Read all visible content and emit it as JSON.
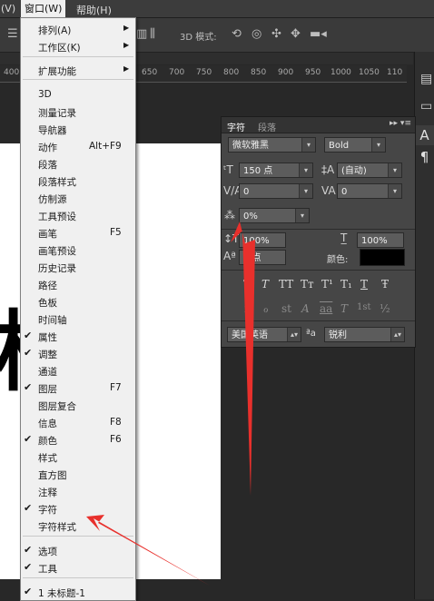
{
  "menubar": {
    "left_cut": "(V)",
    "window": "窗口(W)",
    "help": "帮助(H)"
  },
  "options_bar": {
    "mode_label": "3D 模式:"
  },
  "ruler": {
    "ticks": [
      "400",
      "650",
      "700",
      "750",
      "800",
      "850",
      "900",
      "950",
      "1000",
      "1050",
      "110"
    ]
  },
  "window_menu": {
    "items": [
      {
        "label": "排列(A)",
        "submenu": true
      },
      {
        "label": "工作区(K)",
        "submenu": true
      },
      {
        "label": "扩展功能",
        "submenu": true
      },
      {
        "label": "3D"
      },
      {
        "label": "测量记录"
      },
      {
        "label": "导航器"
      },
      {
        "label": "动作",
        "shortcut": "Alt+F9"
      },
      {
        "label": "段落"
      },
      {
        "label": "段落样式"
      },
      {
        "label": "仿制源"
      },
      {
        "label": "工具预设"
      },
      {
        "label": "画笔",
        "shortcut": "F5"
      },
      {
        "label": "画笔预设"
      },
      {
        "label": "历史记录"
      },
      {
        "label": "路径"
      },
      {
        "label": "色板"
      },
      {
        "label": "时间轴"
      },
      {
        "label": "属性",
        "checked": true
      },
      {
        "label": "调整",
        "checked": true
      },
      {
        "label": "通道"
      },
      {
        "label": "图层",
        "shortcut": "F7",
        "checked": true
      },
      {
        "label": "图层复合"
      },
      {
        "label": "信息",
        "shortcut": "F8"
      },
      {
        "label": "颜色",
        "shortcut": "F6",
        "checked": true
      },
      {
        "label": "样式"
      },
      {
        "label": "直方图"
      },
      {
        "label": "注释"
      },
      {
        "label": "字符",
        "checked": true
      },
      {
        "label": "字符样式"
      },
      {
        "label": "选项",
        "checked": true
      },
      {
        "label": "工具",
        "checked": true
      },
      {
        "label": "1 未标题-1",
        "checked": true
      }
    ]
  },
  "character_panel": {
    "tab_character": "字符",
    "tab_paragraph": "段落",
    "font_family": "微软雅黑",
    "font_style": "Bold",
    "font_size": "150 点",
    "leading": "(自动)",
    "kerning": "0",
    "tracking": "0",
    "tsume": "0%",
    "vertical_scale": "100%",
    "horizontal_scale": "100%",
    "baseline_shift": "0 点",
    "color_label": "颜色:",
    "color_value": "#000000",
    "language": "美国英语",
    "aa_label": "ªa",
    "antialias": "锐利",
    "style_buttons": [
      "T",
      "T",
      "TT",
      "Tт",
      "T¹",
      "T₁",
      "T",
      "Ŧ"
    ],
    "opentype_buttons": [
      "fi",
      "ℴ",
      "st",
      "A",
      "aa",
      "T",
      "1st",
      "½"
    ]
  },
  "canvas": {
    "glyph": "楷"
  },
  "annotations": {
    "arrow_color": "#e8302c"
  }
}
